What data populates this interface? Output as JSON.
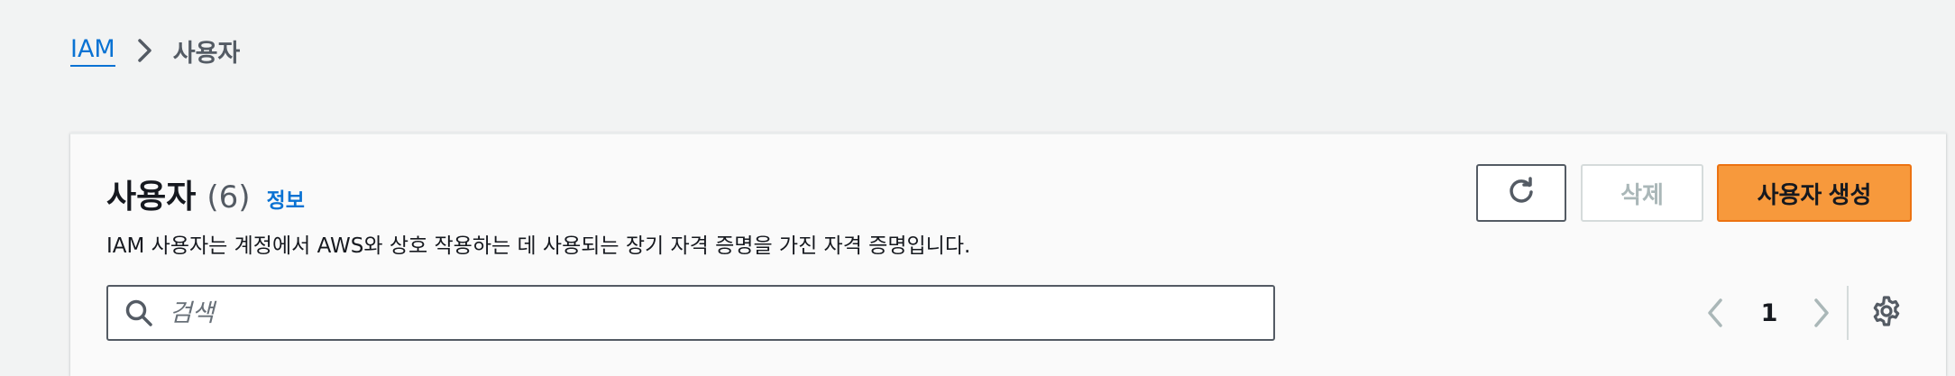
{
  "breadcrumb": {
    "root": "IAM",
    "current": "사용자"
  },
  "panel": {
    "title": "사용자",
    "count": "(6)",
    "info_link": "정보",
    "description": "IAM 사용자는 계정에서 AWS와 상호 작용하는 데 사용되는 장기 자격 증명을 가진 자격 증명입니다."
  },
  "actions": {
    "refresh_icon": "refresh-icon",
    "delete_label": "삭제",
    "create_label": "사용자 생성"
  },
  "search": {
    "placeholder": "검색",
    "value": ""
  },
  "pagination": {
    "current_page": "1"
  },
  "colors": {
    "accent_link": "#0972d3",
    "primary_button": "#f7993c",
    "page_background": "#f2f3f3"
  },
  "icons": {
    "breadcrumb_separator": "chevron-right-icon",
    "search": "search-icon",
    "prev": "chevron-left-icon",
    "next": "chevron-right-icon",
    "settings": "gear-icon"
  }
}
